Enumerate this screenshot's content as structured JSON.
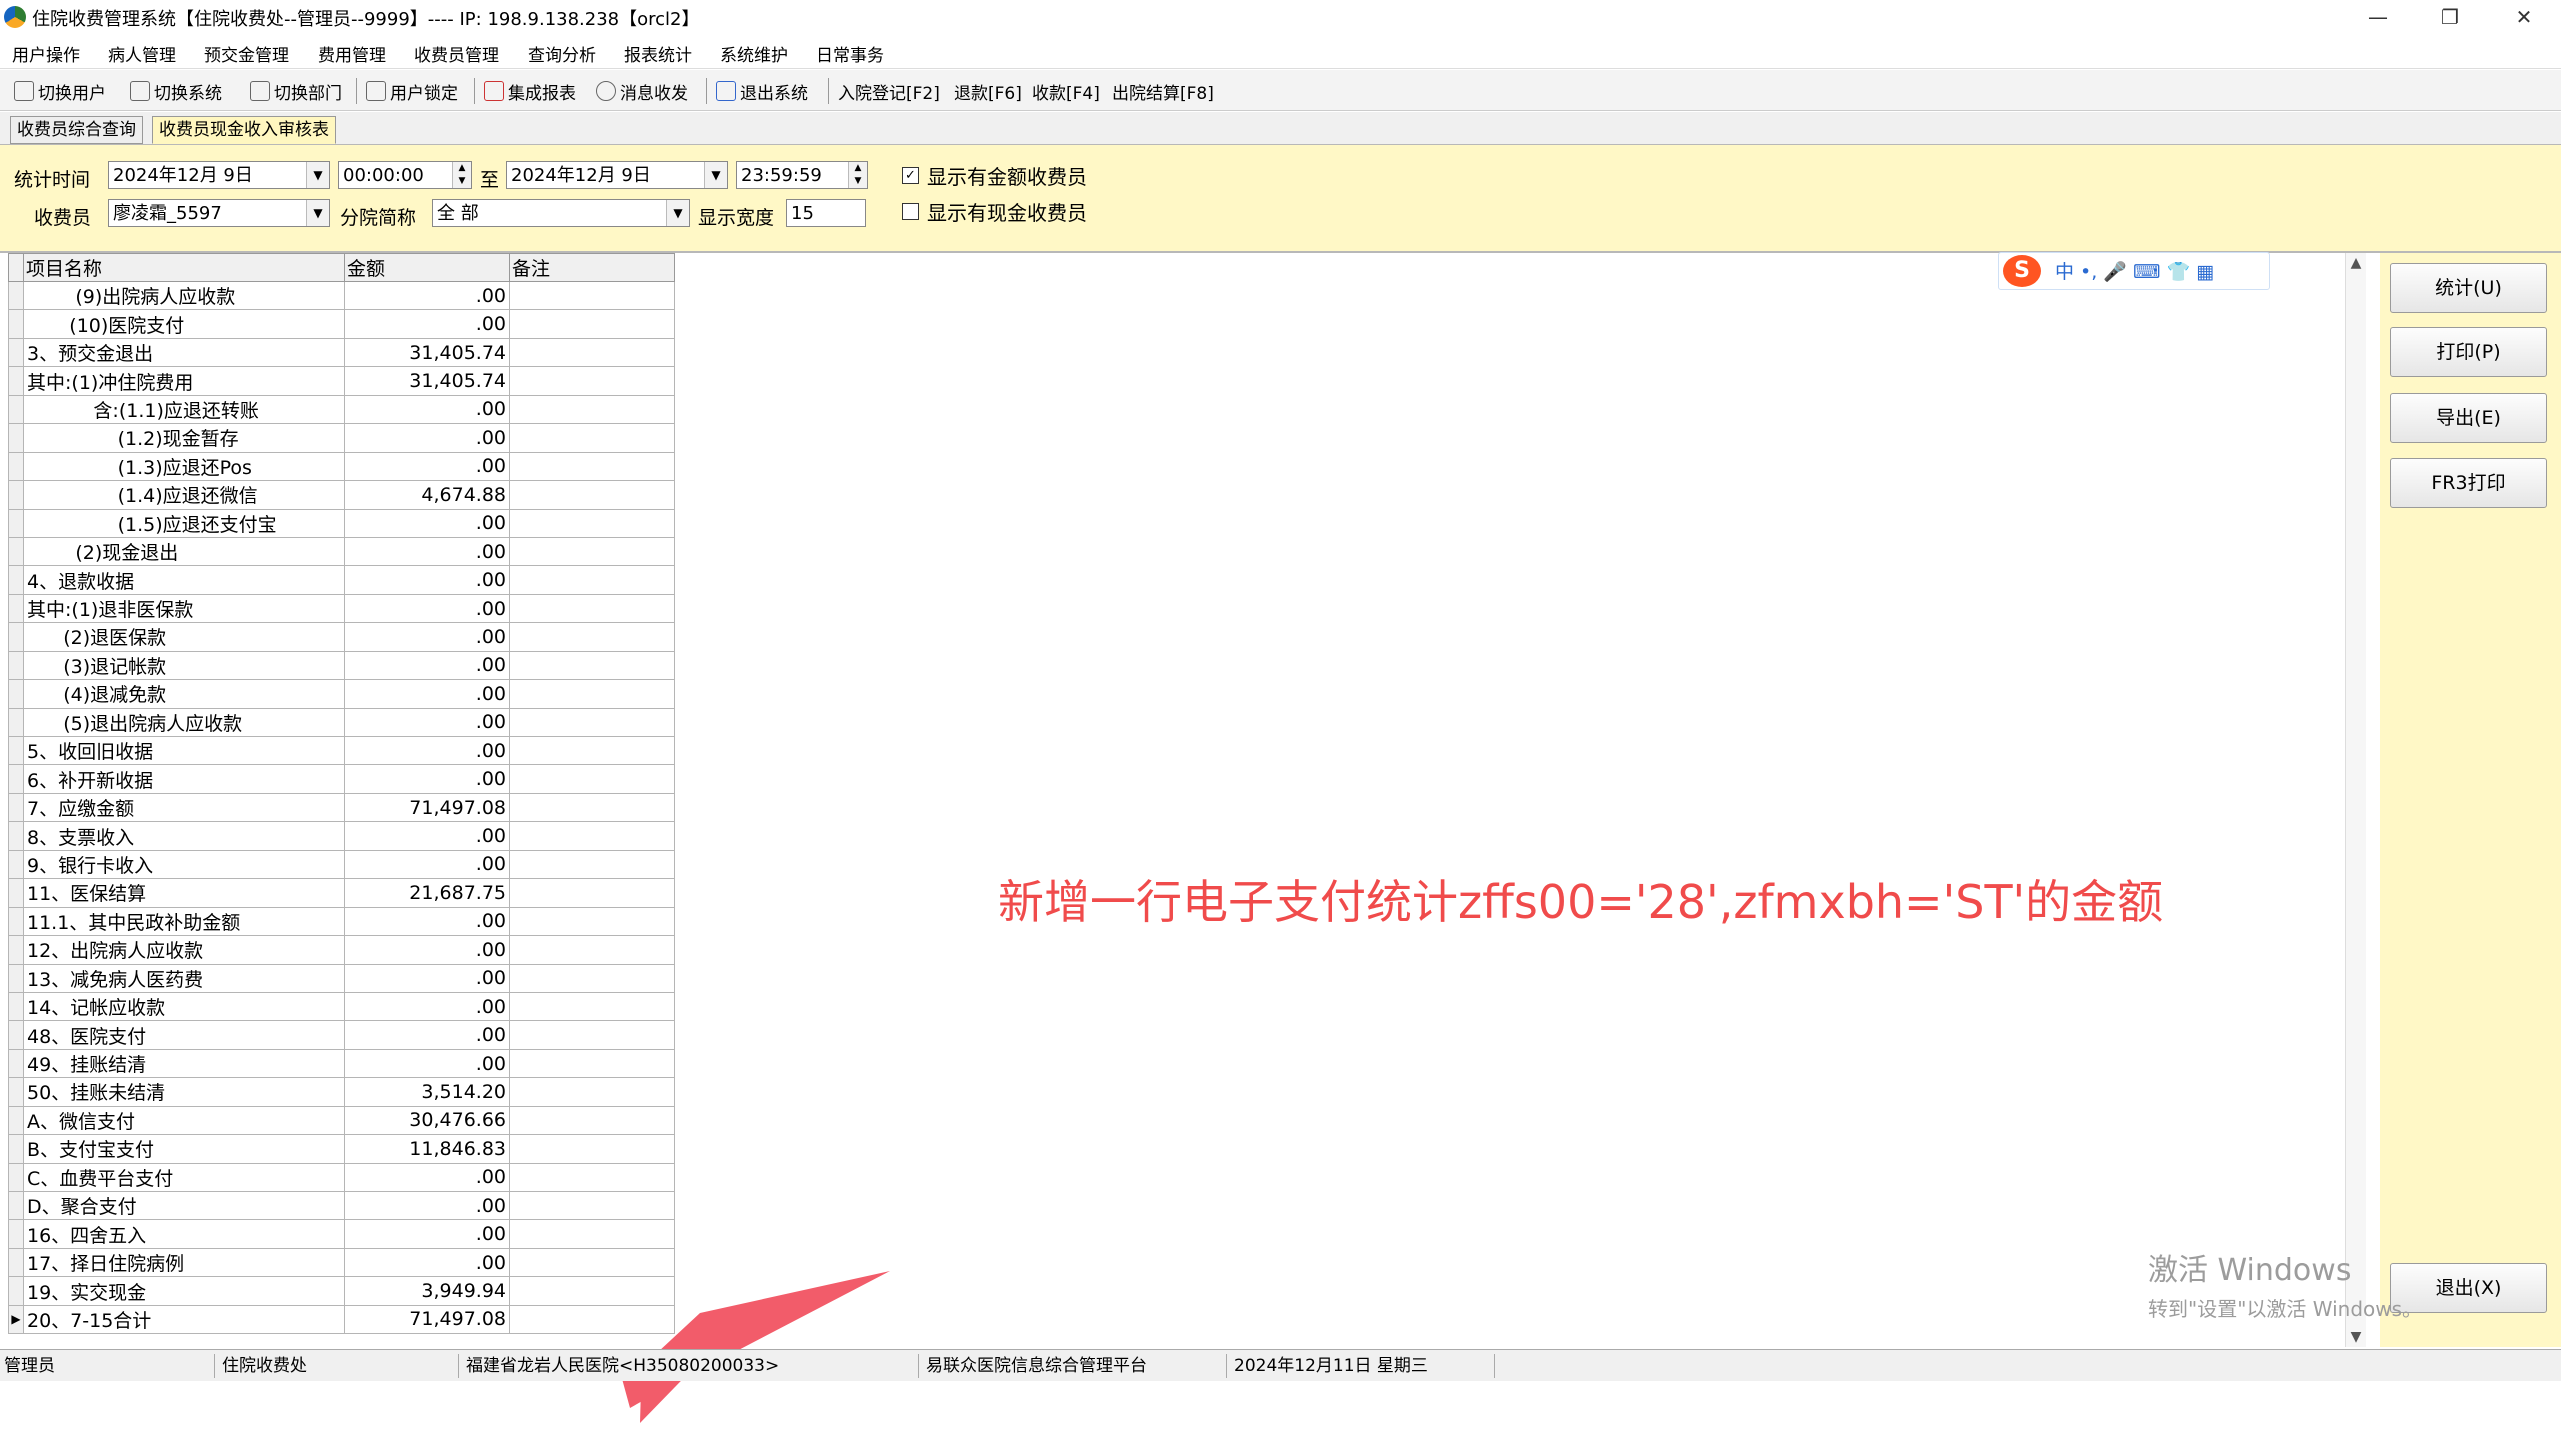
{
  "window": {
    "title": "住院收费管理系统【住院收费处--管理员--9999】---- IP:  198.9.138.238【orcl2】",
    "minimize": "—",
    "restore": "❐",
    "close": "✕"
  },
  "menu": [
    "用户操作",
    "病人管理",
    "预交金管理",
    "费用管理",
    "收费员管理",
    "查询分析",
    "报表统计",
    "系统维护",
    "日常事务"
  ],
  "toolbar": {
    "buttons": [
      "切换用户",
      "切换系统",
      "切换部门",
      "用户锁定",
      "集成报表",
      "消息收发",
      "退出系统"
    ],
    "shortcuts": [
      "入院登记[F2]",
      "退款[F6]",
      "收款[F4]",
      "出院结算[F8]"
    ]
  },
  "tabs": [
    "收费员综合查询",
    "收费员现金收入审核表"
  ],
  "filter": {
    "stat_time_label": "统计时间",
    "start_date": "2024年12月 9日",
    "start_time": "00:00:00",
    "to_label": "至",
    "end_date": "2024年12月 9日",
    "end_time": "23:59:59",
    "cashier_label": "收费员",
    "cashier_value": "廖凌霜_5597",
    "branch_label": "分院简称",
    "branch_value": "全 部",
    "width_label": "显示宽度",
    "width_value": "15",
    "chk_amount_label": "显示有金额收费员",
    "chk_amount_checked": "✓",
    "chk_cash_label": "显示有现金收费员"
  },
  "grid": {
    "columns": [
      "项目名称",
      "金额",
      "备注"
    ],
    "rows": [
      {
        "name": "        (9)出院病人应收款",
        "amount": ".00",
        "note": ""
      },
      {
        "name": "       (10)医院支付",
        "amount": ".00",
        "note": ""
      },
      {
        "name": "3、预交金退出",
        "amount": "31,405.74",
        "note": ""
      },
      {
        "name": "其中:(1)冲住院费用",
        "amount": "31,405.74",
        "note": ""
      },
      {
        "name": "           含:(1.1)应退还转账",
        "amount": ".00",
        "note": ""
      },
      {
        "name": "               (1.2)现金暂存",
        "amount": ".00",
        "note": ""
      },
      {
        "name": "               (1.3)应退还Pos",
        "amount": ".00",
        "note": ""
      },
      {
        "name": "               (1.4)应退还微信",
        "amount": "4,674.88",
        "note": ""
      },
      {
        "name": "               (1.5)应退还支付宝",
        "amount": ".00",
        "note": ""
      },
      {
        "name": "        (2)现金退出",
        "amount": ".00",
        "note": ""
      },
      {
        "name": "4、退款收据",
        "amount": ".00",
        "note": ""
      },
      {
        "name": "其中:(1)退非医保款",
        "amount": ".00",
        "note": ""
      },
      {
        "name": "      (2)退医保款",
        "amount": ".00",
        "note": ""
      },
      {
        "name": "      (3)退记帐款",
        "amount": ".00",
        "note": ""
      },
      {
        "name": "      (4)退减免款",
        "amount": ".00",
        "note": ""
      },
      {
        "name": "      (5)退出院病人应收款",
        "amount": ".00",
        "note": ""
      },
      {
        "name": "5、收回旧收据",
        "amount": ".00",
        "note": ""
      },
      {
        "name": "6、补开新收据",
        "amount": ".00",
        "note": ""
      },
      {
        "name": "7、应缴金额",
        "amount": "71,497.08",
        "note": ""
      },
      {
        "name": "8、支票收入",
        "amount": ".00",
        "note": ""
      },
      {
        "name": "9、银行卡收入",
        "amount": ".00",
        "note": ""
      },
      {
        "name": "11、医保结算",
        "amount": "21,687.75",
        "note": ""
      },
      {
        "name": "11.1、其中民政补助金额",
        "amount": ".00",
        "note": ""
      },
      {
        "name": "12、出院病人应收款",
        "amount": ".00",
        "note": ""
      },
      {
        "name": "13、减免病人医药费",
        "amount": ".00",
        "note": ""
      },
      {
        "name": "14、记帐应收款",
        "amount": ".00",
        "note": ""
      },
      {
        "name": "48、医院支付",
        "amount": ".00",
        "note": ""
      },
      {
        "name": "49、挂账结清",
        "amount": ".00",
        "note": ""
      },
      {
        "name": "50、挂账未结清",
        "amount": "3,514.20",
        "note": ""
      },
      {
        "name": "A、微信支付",
        "amount": "30,476.66",
        "note": ""
      },
      {
        "name": "B、支付宝支付",
        "amount": "11,846.83",
        "note": ""
      },
      {
        "name": "C、血费平台支付",
        "amount": ".00",
        "note": ""
      },
      {
        "name": "D、聚合支付",
        "amount": ".00",
        "note": ""
      },
      {
        "name": "16、四舍五入",
        "amount": ".00",
        "note": ""
      },
      {
        "name": "17、择日住院病例",
        "amount": ".00",
        "note": ""
      },
      {
        "name": "19、实交现金",
        "amount": "3,949.94",
        "note": ""
      },
      {
        "name": "20、7-15合计",
        "amount": "71,497.08",
        "note": ""
      }
    ],
    "current_row_marker": "▶",
    "current_row_index": 36
  },
  "side_buttons": {
    "stat": "统计(U)",
    "print": "打印(P)",
    "export": "导出(E)",
    "fr3_print": "FR3打印",
    "exit": "退出(X)"
  },
  "ime": {
    "logo": "S",
    "text": "中 •, 🎤 ⌨ 👕 ▦"
  },
  "annotation": "新增一行电子支付统计zffs00='28',zfmxbh='ST'的金额",
  "watermark": {
    "line1": "激活 Windows",
    "line2": "转到\"设置\"以激活 Windows。"
  },
  "status": [
    "管理员",
    "住院收费处",
    "福建省龙岩人民医院<H35080200033>",
    "易联众医院信息综合管理平台",
    "2024年12月11日 星期三"
  ],
  "colors": {
    "accent_yellow": "#fff8c6",
    "annotation_red": "#f04b4b",
    "arrow_pink": "#f25c6a"
  }
}
